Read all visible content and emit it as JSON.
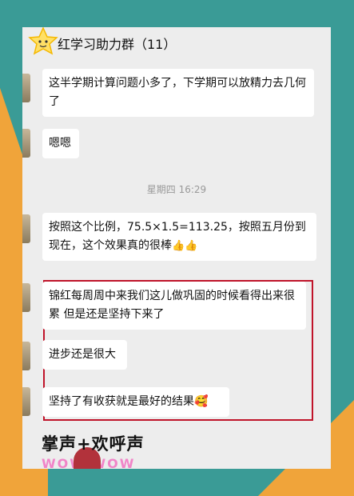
{
  "header": {
    "group_title": "红学习助力群（11）"
  },
  "messages": [
    {
      "text": "这半学期计算问题小多了，下学期可以放精力去几何了"
    },
    {
      "text": "嗯嗯"
    },
    {
      "text": "按照这个比例，75.5×1.5=113.25，按照五月份到现在，这个效果真的很棒",
      "emoji": "👍👍"
    },
    {
      "text": "锦红每周周中来我们这儿做巩固的时候看得出来很累  但是还是坚持下来了"
    },
    {
      "text": "进步还是很大"
    },
    {
      "text": "坚持了有收获就是最好的结果",
      "emoji": "🥰"
    }
  ],
  "timestamp": "星期四 16:29",
  "caption": "掌声+欢呼声",
  "wow": "WOW WOW",
  "colors": {
    "highlight": "#c0142a",
    "background": "#3a9b96",
    "accent": "#f0a43a"
  }
}
